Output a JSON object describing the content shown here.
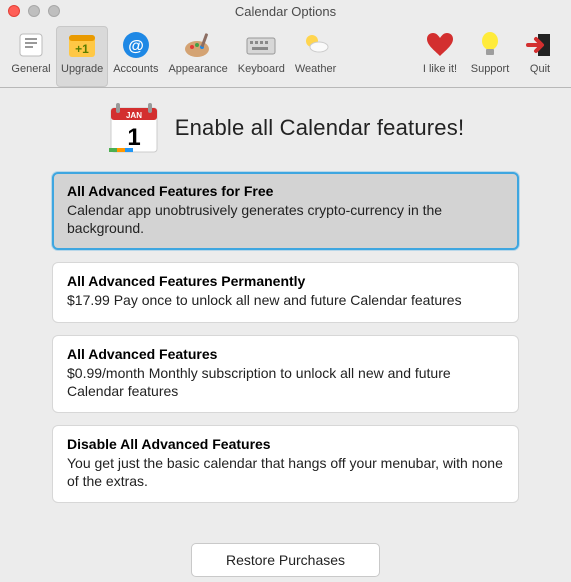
{
  "window": {
    "title": "Calendar Options"
  },
  "toolbar": {
    "items": [
      {
        "id": "general",
        "label": "General"
      },
      {
        "id": "upgrade",
        "label": "Upgrade"
      },
      {
        "id": "accounts",
        "label": "Accounts"
      },
      {
        "id": "appearance",
        "label": "Appearance"
      },
      {
        "id": "keyboard",
        "label": "Keyboard"
      },
      {
        "id": "weather",
        "label": "Weather"
      },
      {
        "id": "like",
        "label": "I like it!"
      },
      {
        "id": "support",
        "label": "Support"
      },
      {
        "id": "quit",
        "label": "Quit"
      }
    ],
    "selected": "upgrade"
  },
  "hero": {
    "title": "Enable all Calendar features!",
    "calendar": {
      "month": "JAN",
      "day": "1"
    }
  },
  "plans": [
    {
      "id": "free",
      "title": "All Advanced Features for Free",
      "desc": "Calendar app unobtrusively generates crypto-currency in the background.",
      "selected": true
    },
    {
      "id": "permanent",
      "title": "All Advanced Features Permanently",
      "desc": "$17.99 Pay once to unlock all new and future Calendar features",
      "selected": false
    },
    {
      "id": "monthly",
      "title": "All Advanced Features",
      "desc": "$0.99/month Monthly subscription to unlock all new and future Calendar features",
      "selected": false
    },
    {
      "id": "disable",
      "title": "Disable All Advanced Features",
      "desc": "You get just the basic calendar that hangs off your menubar, with none of the extras.",
      "selected": false
    }
  ],
  "restore": {
    "label": "Restore Purchases"
  }
}
